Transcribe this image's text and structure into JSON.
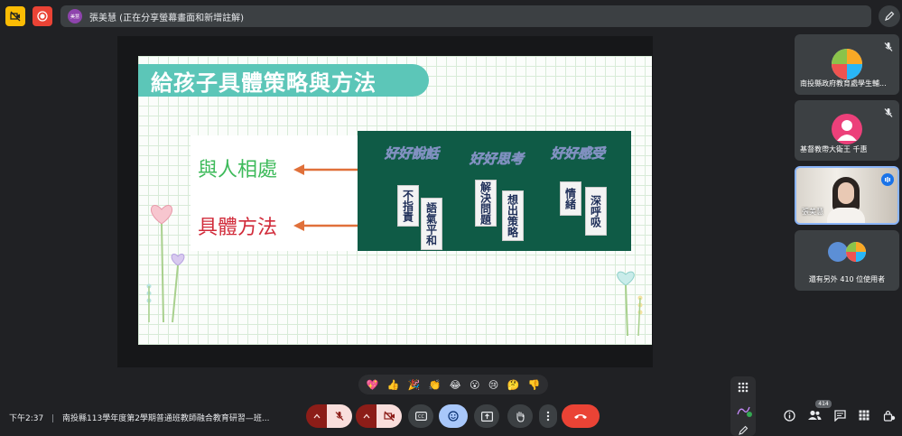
{
  "presenter": {
    "avatar_label": "美慧",
    "status_text": "張美慧 (正在分享螢幕畫面和新增註解)"
  },
  "slide": {
    "title": "給孩子具體策略與方法",
    "label_1": "與人相處",
    "label_2": "具體方法",
    "photo": {
      "heading_1": "好好說話",
      "heading_2": "好好思考",
      "heading_3": "好好感受",
      "cards": [
        "不指責",
        "語氣平和",
        "解決問題",
        "想出策略",
        "情緒",
        "深呼吸"
      ]
    }
  },
  "participants": [
    {
      "name": "南投縣政府教育處學生輔...",
      "muted": true
    },
    {
      "name": "基督教帶大衛王 千惠",
      "muted": true
    },
    {
      "name": "張美慧",
      "speaking": true
    },
    {
      "name": "還有另外 410 位使用者"
    }
  ],
  "reactions": [
    "💖",
    "👍",
    "🎉",
    "👏",
    "😂",
    "😮",
    "😢",
    "🤔",
    "👎"
  ],
  "meeting": {
    "time": "下午2:37",
    "separator": "|",
    "title": "南投縣113學年度第2學期普通班教師融合教育研習—班..."
  },
  "people_count": "414",
  "colors": {
    "accent_red": "#ea4335",
    "slide_title_bg": "#5cc6b8",
    "label_green": "#3dba5a",
    "label_red": "#d12b3a"
  }
}
